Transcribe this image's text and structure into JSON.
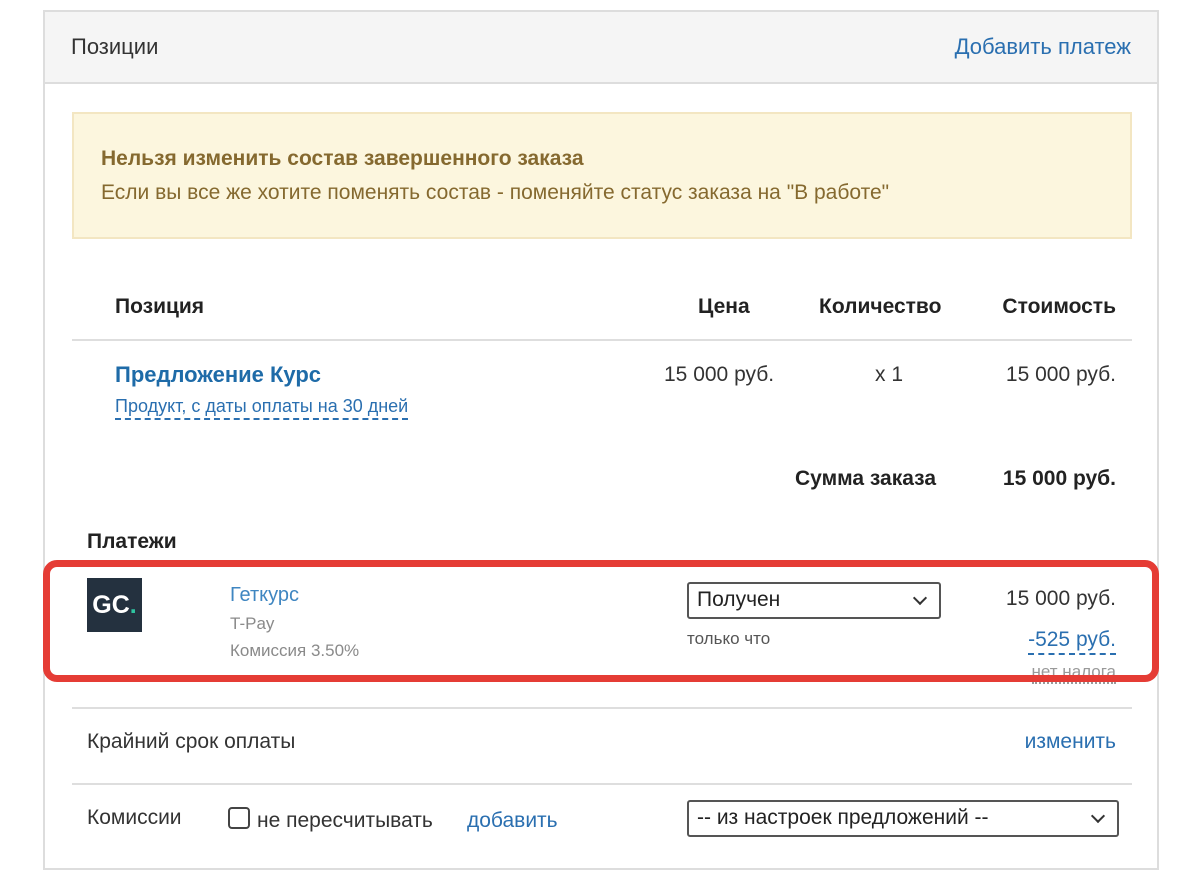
{
  "header": {
    "title": "Позиции",
    "add_payment": "Добавить платеж"
  },
  "warning": {
    "title": "Нельзя изменить состав завершенного заказа",
    "text": "Если вы все же хотите поменять состав - поменяйте статус заказа на \"В работе\""
  },
  "table": {
    "columns": [
      "Позиция",
      "Цена",
      "Количество",
      "Стоимость"
    ],
    "rows": [
      {
        "name": "Предложение Курс",
        "description": "Продукт, с даты оплаты на 30 дней",
        "price": "15 000 руб.",
        "quantity": "x 1",
        "cost": "15 000 руб."
      }
    ],
    "total_label": "Сумма заказа",
    "total_value": "15 000 руб."
  },
  "payments": {
    "heading": "Платежи",
    "items": [
      {
        "logo_text": "GC",
        "logo_dot": ".",
        "name": "Геткурс",
        "method": "T-Pay",
        "fee": "Комиссия 3.50%",
        "status": "Получен",
        "time": "только что",
        "amount": "15 000 руб.",
        "fee_amount": "-525 руб.",
        "tax": "нет налога"
      }
    ]
  },
  "deadline": {
    "label": "Крайний срок оплаты",
    "change": "изменить"
  },
  "commissions": {
    "label": "Комиссии",
    "checkbox_label": "не пересчитывать",
    "add": "добавить",
    "select_value": "-- из настроек предложений --"
  },
  "colors": {
    "link": "#2a6fb0",
    "warning_bg": "#fcf6de",
    "warning_text": "#85692f",
    "highlight": "#e53c35"
  }
}
